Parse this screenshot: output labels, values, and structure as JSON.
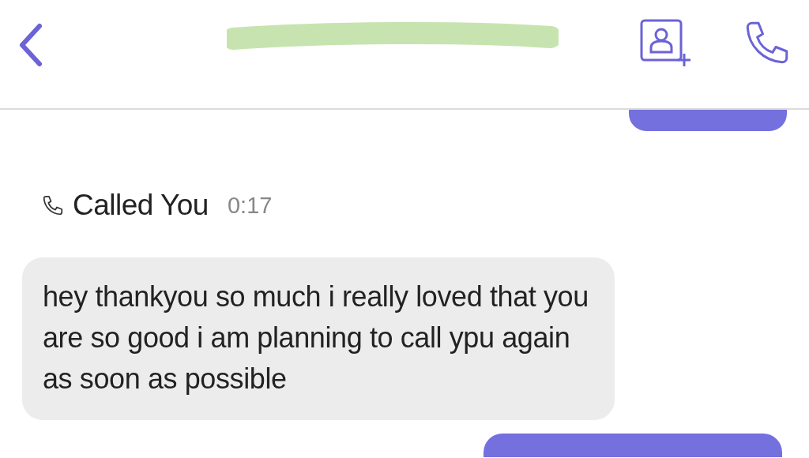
{
  "header": {
    "title_redacted": true
  },
  "messages": [
    {
      "kind": "outgoing"
    },
    {
      "kind": "call",
      "label": "Called You",
      "duration": "0:17"
    },
    {
      "kind": "incoming",
      "text": "hey thankyou so much i really loved that you are so good i am planning to call ypu again as soon as possible"
    },
    {
      "kind": "outgoing"
    }
  ]
}
